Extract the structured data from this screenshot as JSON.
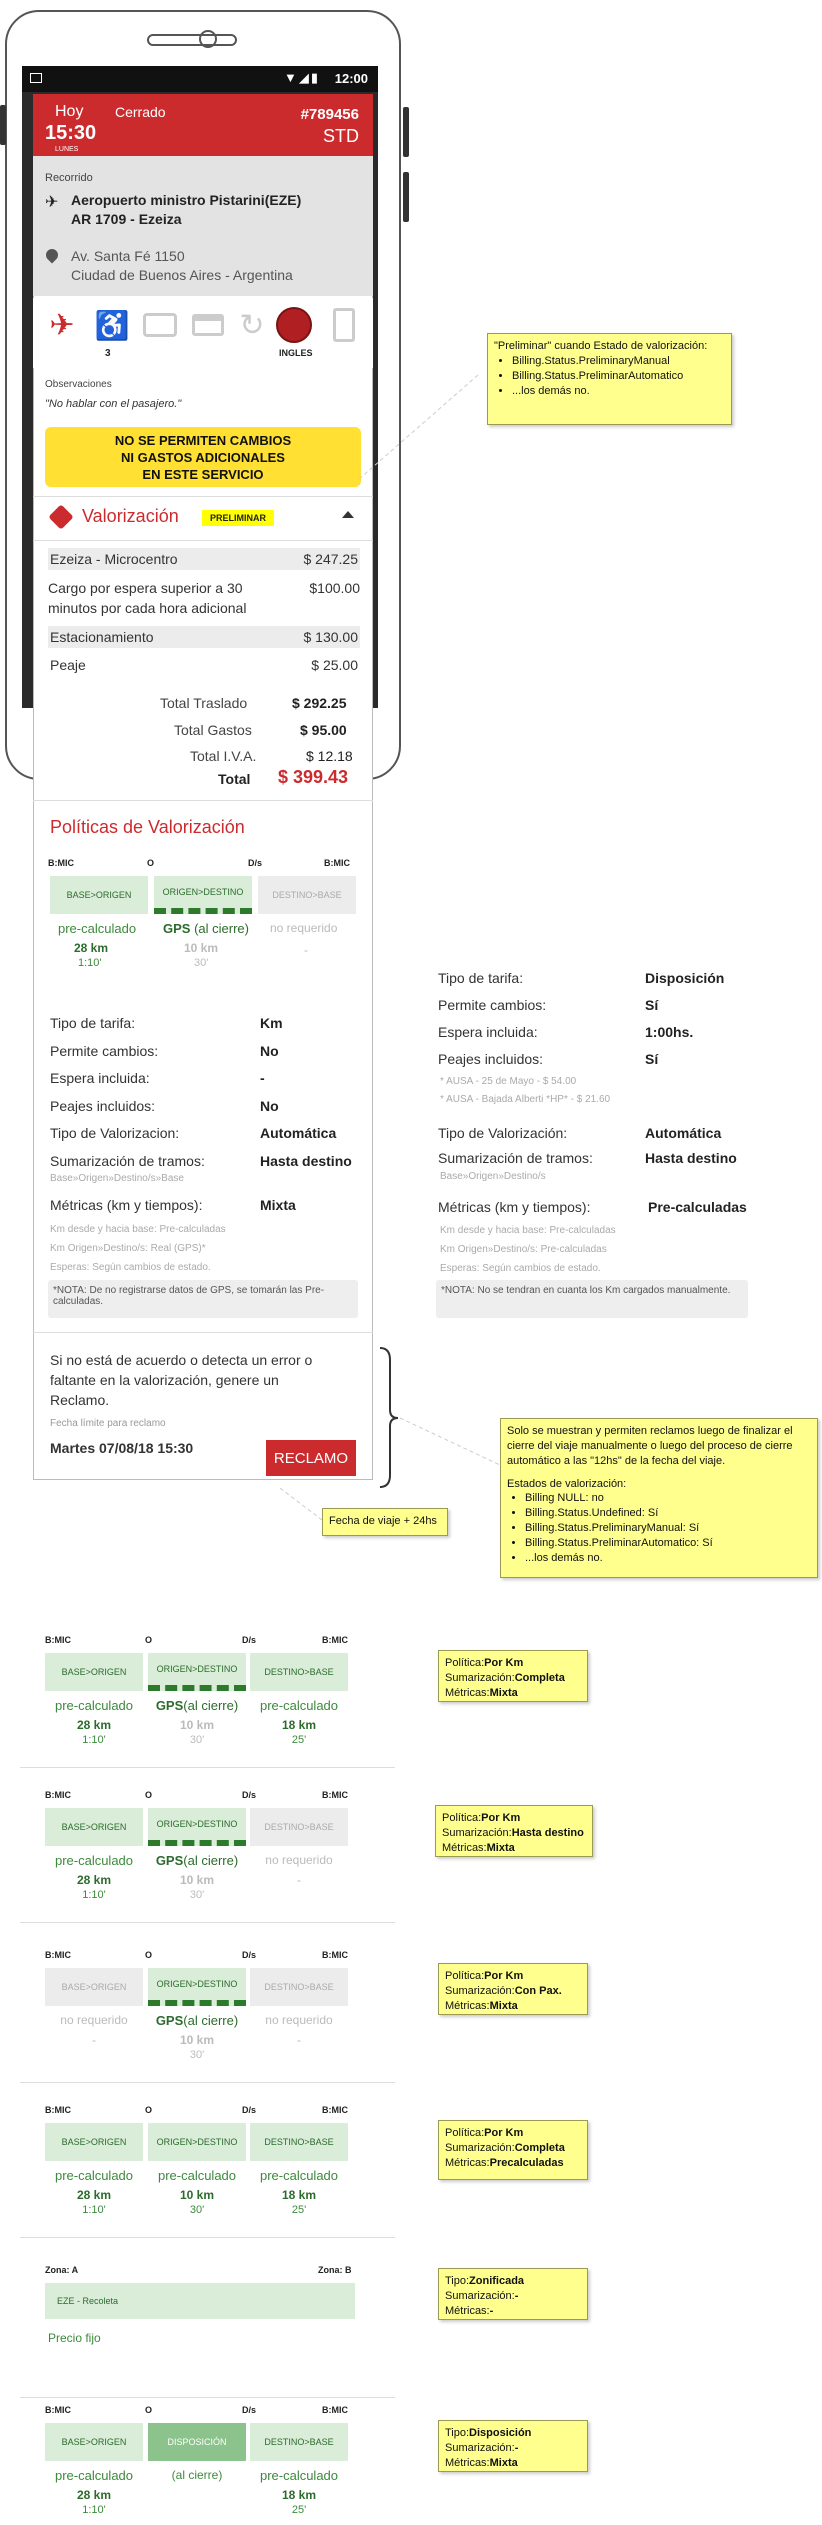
{
  "status": {
    "time": "12:00"
  },
  "header": {
    "day": "Hoy",
    "state": "Cerrado",
    "hour": "15:30",
    "weekday": "LUNES",
    "number": "#789456",
    "type": "STD"
  },
  "route": {
    "label": "Recorrido",
    "airport": "Aeropuerto ministro Pistarini(EZE)",
    "flight": "AR 1709 - Ezeiza",
    "address": "Av. Santa Fé 1150",
    "city": "Ciudad de Buenos Aires - Argentina"
  },
  "icons": {
    "passengers_count": "3",
    "language": "INGLES",
    "names": [
      "plane-departure-icon",
      "wheelchair-icon",
      "luggage-icon",
      "credit-card-icon",
      "refresh-icon",
      "globe-icon",
      "no-phone-icon"
    ]
  },
  "observations": {
    "label": "Observaciones",
    "text": "\"No hablar con el pasajero.\""
  },
  "banner": {
    "line1": "NO SE PERMITEN CAMBIOS",
    "line2": "NI GASTOS ADICIONALES",
    "line3": "EN ESTE SERVICIO"
  },
  "valorizacion": {
    "title": "Valorización",
    "badge": "PRELIMINAR",
    "items": [
      {
        "label": "Ezeiza - Microcentro",
        "value": "$ 247.25"
      },
      {
        "label": "Cargo por espera superior a 30 minutos por cada hora adicional",
        "value": "$100.00"
      },
      {
        "label": "Estacionamiento",
        "value": "$ 130.00"
      },
      {
        "label": "Peaje",
        "value": "$ 25.00"
      }
    ],
    "totals": [
      {
        "label": "Total Traslado",
        "value": "$ 292.25"
      },
      {
        "label": "Total Gastos",
        "value": "$ 95.00"
      },
      {
        "label": "Total I.V.A.",
        "value": "$ 12.18"
      },
      {
        "label": "Total",
        "value": "$ 399.43"
      }
    ]
  },
  "politicas": {
    "title": "Políticas de Valorización"
  },
  "segments": {
    "bmic": "B:MIC",
    "o": "O",
    "ds": "D/s",
    "base_origen": "BASE>ORIGEN",
    "origen_destino": "ORIGEN>DESTINO",
    "destino_base": "DESTINO>BASE",
    "disposicion": "DISPOSICIÓN",
    "precalc": "pre-calculado",
    "gps": "GPS",
    "gps_suffix": "(al cierre)",
    "al_cierre": "(al cierre)",
    "no_req": "no requerido",
    "km28": "28 km",
    "km10": "10 km",
    "km18": "18 km",
    "t110": "1:10'",
    "t30": "30'",
    "t25": "25'",
    "dash": "-",
    "zona_a": "Zona: A",
    "zona_b": "Zona: B",
    "zona_label": "EZE - Recoleta",
    "precio_fijo": "Precio fijo"
  },
  "tarifa": {
    "rows": [
      {
        "label": "Tipo de tarifa:",
        "value": "Km"
      },
      {
        "label": "Permite cambios:",
        "value": "No"
      },
      {
        "label": "Espera incluida:",
        "value": "-"
      },
      {
        "label": "Peajes incluidos:",
        "value": "No"
      },
      {
        "label": "Tipo de Valorizacion:",
        "value": "Automática"
      },
      {
        "label": "Sumarización de tramos:",
        "value": "Hasta destino"
      }
    ],
    "sum_note": "Base»Origen»Destino/s»Base",
    "metrics_label": "Métricas (km y tiempos):",
    "metrics_value": "Mixta",
    "m1": "Km desde y hacia base: Pre-calculadas",
    "m2": "Km Origen»Destino/s: Real (GPS)*",
    "m3": "Esperas: Según cambios de estado.",
    "nota": "*NOTA: De no registrarse datos de GPS, se tomarán las Pre-calculadas."
  },
  "tarifa2": {
    "rows": [
      {
        "label": "Tipo de tarifa:",
        "value": "Disposición"
      },
      {
        "label": "Permite cambios:",
        "value": "Sí"
      },
      {
        "label": "Espera incluida:",
        "value": "1:00hs."
      },
      {
        "label": "Peajes incluidos:",
        "value": "Sí"
      }
    ],
    "p1": "* AUSA - 25 de Mayo - $ 54.00",
    "p2": "* AUSA - Bajada Alberti *HP* - $ 21.60",
    "rows2": [
      {
        "label": "Tipo de Valorización:",
        "value": "Automática"
      },
      {
        "label": "Sumarización de tramos:",
        "value": "Hasta destino"
      }
    ],
    "sum_note": "Base»Origen»Destino/s",
    "metrics_label": "Métricas (km y tiempos):",
    "metrics_value": "Pre-calculadas",
    "m1": "Km desde y hacia base: Pre-calculadas",
    "m2": "Km Origen»Destino/s: Pre-calculadas",
    "m3": "Esperas: Según cambios de estado.",
    "nota": "*NOTA: No se tendran en cuanta los Km cargados manualmente."
  },
  "reclamo": {
    "text": "Si no está de acuerdo o detecta un error o faltante en la valorización, genere un Reclamo.",
    "deadline_label": "Fecha límite para reclamo",
    "deadline": "Martes 07/08/18 15:30",
    "button": "RECLAMO"
  },
  "notes": {
    "n1_title": "\"Preliminar\" cuando Estado de valorización:",
    "n1_items": [
      "Billing.Status.PreliminaryManual",
      "Billing.Status.PreliminarAutomatico",
      "...los demás no."
    ],
    "n2": "Fecha de viaje + 24hs",
    "n3_text": "Solo se muestran y permiten reclamos luego de finalizar el cierre del viaje manualmente o luego del proceso de cierre automático a las \"12hs\" de la fecha del viaje.",
    "n3_sub": "Estados de valorización:",
    "n3_items": [
      "Billing NULL: no",
      "Billing.Status.Undefined: Sí",
      "Billing.Status.PreliminaryManual: Sí",
      "Billing.Status.PreliminarAutomatico: Sí",
      "...los demás no."
    ],
    "p": [
      {
        "k1": "Política:",
        "v1": "Por Km",
        "k2": "Sumarización:",
        "v2": "Completa",
        "k3": "Métricas:",
        "v3": "Mixta"
      },
      {
        "k1": "Política:",
        "v1": "Por Km",
        "k2": "Sumarización:",
        "v2": "Hasta destino",
        "k3": "Métricas:",
        "v3": "Mixta"
      },
      {
        "k1": "Política:",
        "v1": "Por Km",
        "k2": "Sumarización:",
        "v2": "Con Pax.",
        "k3": "Métricas:",
        "v3": "Mixta"
      },
      {
        "k1": "Política:",
        "v1": "Por Km",
        "k2": "Sumarización:",
        "v2": "Completa",
        "k3": "Métricas:",
        "v3": "Precalculadas"
      },
      {
        "k1": "Tipo:",
        "v1": "Zonificada",
        "k2": "Sumarización:",
        "v2": "-",
        "k3": "Métricas:",
        "v3": "-"
      },
      {
        "k1": "Tipo:",
        "v1": "Disposición",
        "k2": "Sumarización:",
        "v2": "-",
        "k3": "Métricas:",
        "v3": "Mixta"
      }
    ]
  }
}
